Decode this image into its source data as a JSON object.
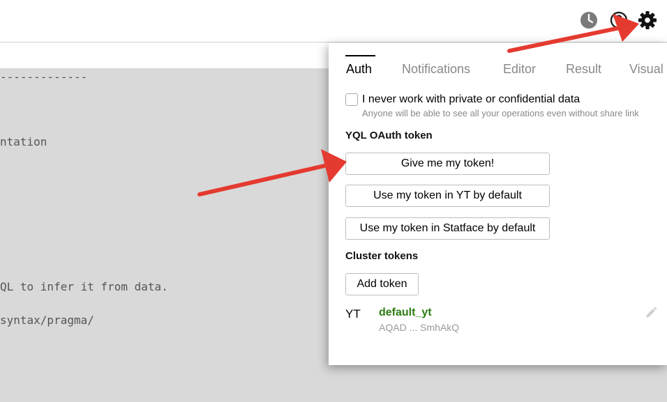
{
  "topbar": {
    "icons": [
      "clock-icon",
      "help-icon",
      "gear-icon"
    ]
  },
  "editor": {
    "code_lines": [
      "-------------",
      "ntation",
      "QL to infer it from data.",
      "syntax/pragma/"
    ]
  },
  "settings": {
    "tabs": [
      {
        "label": "Auth",
        "active": true
      },
      {
        "label": "Notifications",
        "active": false
      },
      {
        "label": "Editor",
        "active": false
      },
      {
        "label": "Result",
        "active": false
      },
      {
        "label": "Visual",
        "active": false
      }
    ],
    "private_data": {
      "label": "I never work with private or confidential data",
      "hint": "Anyone will be able to see all your operations even without share link",
      "checked": false
    },
    "oauth": {
      "title": "YQL OAuth token",
      "give_token_label": "Give me my token!",
      "use_yt_label": "Use my token in YT by default",
      "use_statface_label": "Use my token in Statface by default"
    },
    "cluster": {
      "title": "Cluster tokens",
      "add_label": "Add token",
      "tokens": [
        {
          "cluster": "YT",
          "name": "default_yt",
          "value": "AQAD ... SmhAkQ"
        }
      ]
    }
  },
  "colors": {
    "arrow": "#e53a2f",
    "token_name": "#2d7d12",
    "editor_bg": "#d9d9d9"
  }
}
